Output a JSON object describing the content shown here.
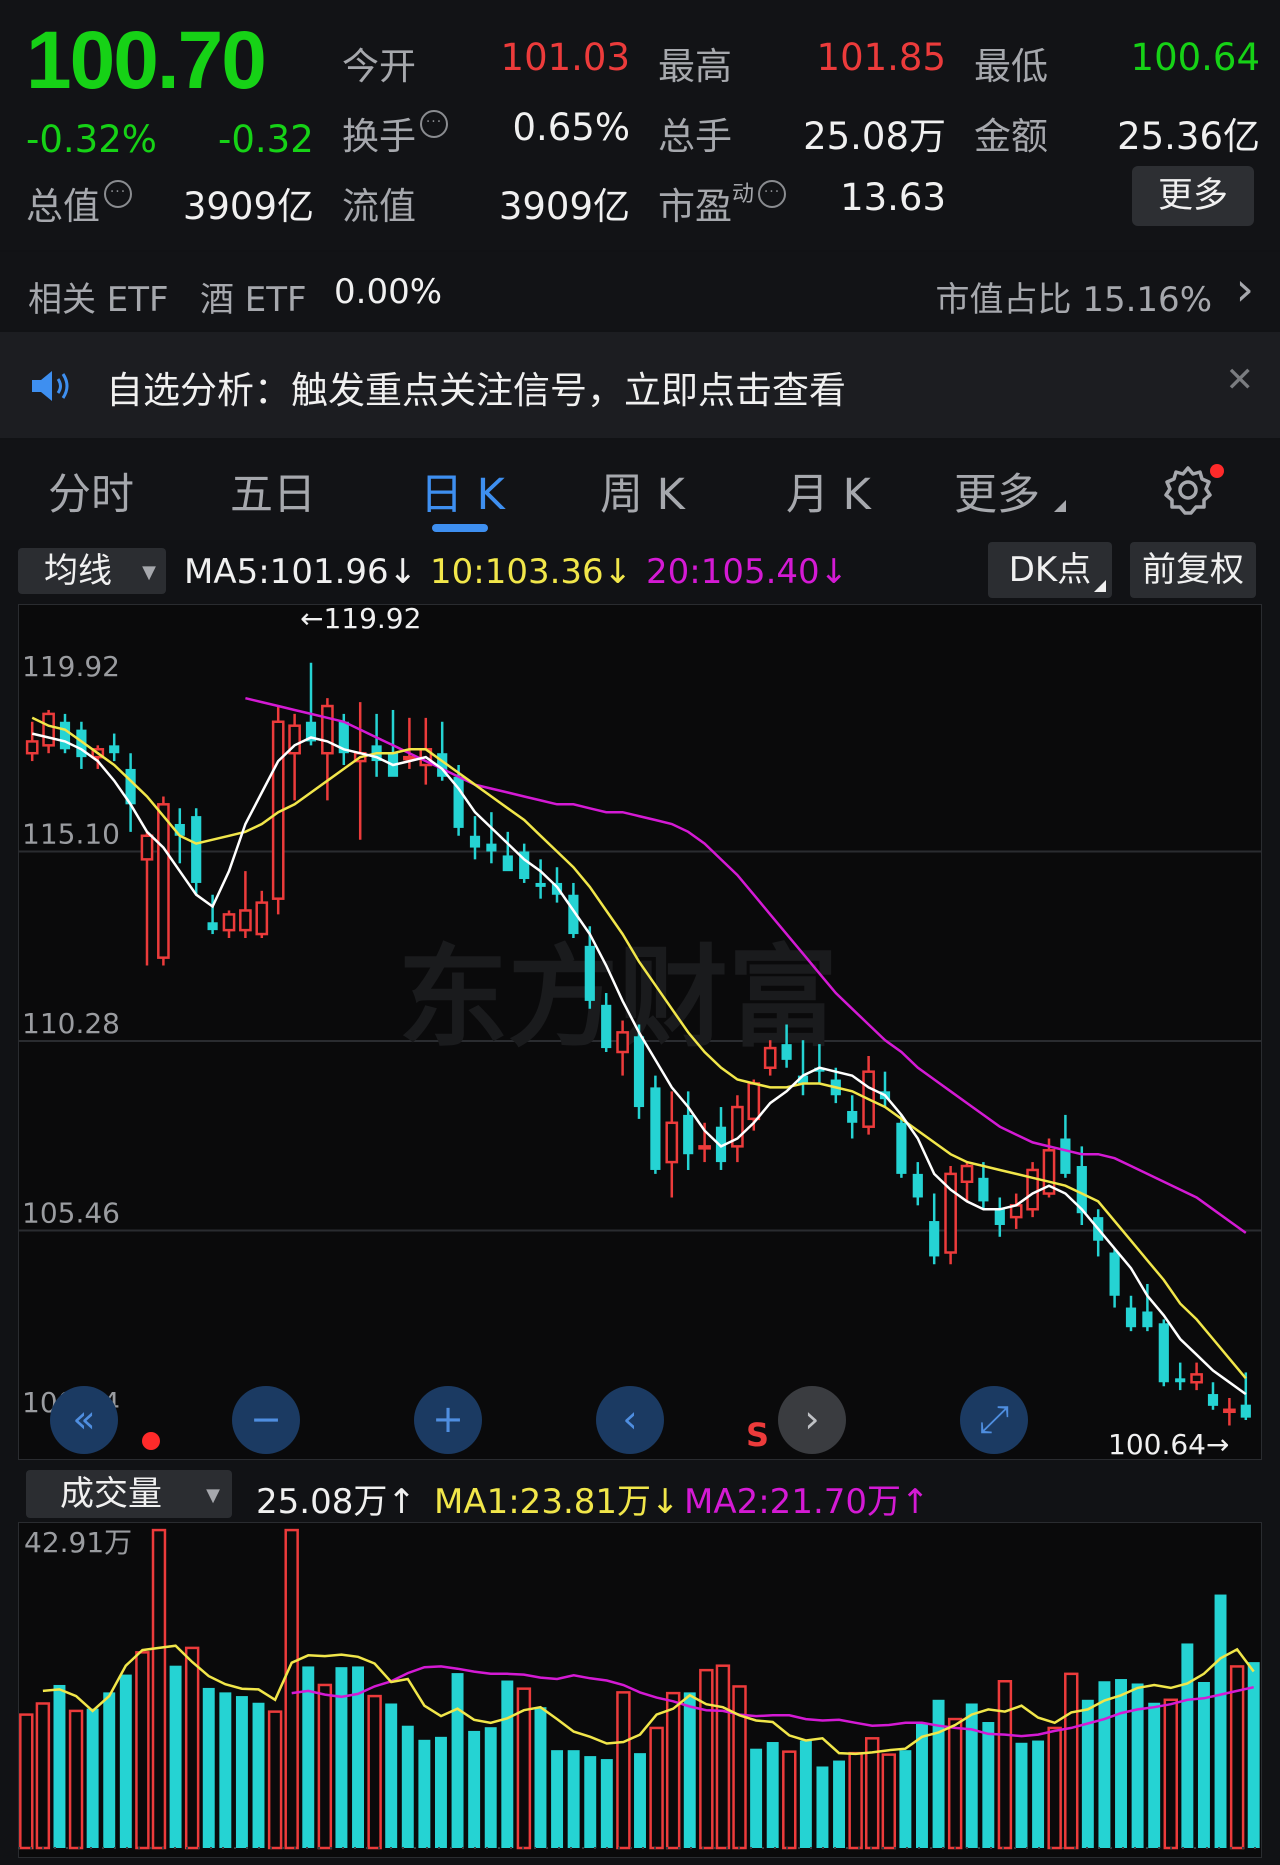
{
  "quote": {
    "price": "100.70",
    "change_pct": "-0.32%",
    "change": "-0.32",
    "open_label": "今开",
    "open": "101.03",
    "high_label": "最高",
    "high": "101.85",
    "low_label": "最低",
    "low": "100.64",
    "turnover_label": "换手",
    "turnover": "0.65%",
    "volume_label": "总手",
    "volume": "25.08万",
    "amount_label": "金额",
    "amount": "25.36亿",
    "mktcap_label": "总值",
    "mktcap": "3909亿",
    "float_label": "流值",
    "float_cap": "3909亿",
    "pe_label": "市盈",
    "pe_sup": "动",
    "pe": "13.63",
    "more_label": "更多",
    "info_icon_text": "···"
  },
  "etf": {
    "label": "相关 ETF",
    "name": "酒 ETF",
    "value": "0.00%",
    "share": "市值占比 15.16%",
    "arrow": "›"
  },
  "notice": {
    "text": "自选分析：触发重点关注信号，立即点击查看",
    "close": "✕"
  },
  "tabs": [
    {
      "label": "分时"
    },
    {
      "label": "五日"
    },
    {
      "label": "日 K"
    },
    {
      "label": "周 K"
    },
    {
      "label": "月 K"
    },
    {
      "label": "更多"
    }
  ],
  "ma_bar": {
    "select_label": "均线",
    "ma5": "MA5:101.96↓",
    "ma10": "10:103.36↓",
    "ma20": "20:105.40↓",
    "dk_label": "DK点",
    "adj_label": "前复权"
  },
  "price_axis": {
    "labels": [
      "119.92",
      "115.10",
      "110.28",
      "105.46",
      "100.64"
    ],
    "max_marker": "←119.92",
    "min_marker": "100.64→",
    "sell_marker": "S"
  },
  "controls": [
    "«",
    "−",
    "+",
    "‹",
    "›",
    "⤢"
  ],
  "vol_bar": {
    "select_label": "成交量",
    "vol": "25.08万↑",
    "ma1": "MA1:23.81万↓",
    "ma2": "MA2:21.70万↑",
    "axis_top": "42.91万"
  },
  "colors": {
    "up": "#ec3b3b",
    "down": "#25d3d3",
    "ma5": "#ffffff",
    "ma10": "#f1e64a",
    "ma20": "#d41ad4",
    "price_green": "#16d216",
    "accent": "#3e8ff0"
  },
  "chart_data": [
    {
      "type": "candlestick",
      "title": "",
      "ylim": [
        100.64,
        119.92
      ],
      "y_ticks": [
        119.92,
        115.1,
        110.28,
        105.46,
        100.64
      ],
      "candles": [
        {
          "o": 117.6,
          "h": 118.4,
          "l": 117.4,
          "c": 117.9
        },
        {
          "o": 117.8,
          "h": 118.7,
          "l": 117.6,
          "c": 118.6
        },
        {
          "o": 118.4,
          "h": 118.6,
          "l": 117.6,
          "c": 117.7
        },
        {
          "o": 118.2,
          "h": 118.4,
          "l": 117.2,
          "c": 117.5
        },
        {
          "o": 117.5,
          "h": 117.8,
          "l": 117.2,
          "c": 117.7
        },
        {
          "o": 117.8,
          "h": 118.1,
          "l": 117.4,
          "c": 117.6
        },
        {
          "o": 117.2,
          "h": 117.6,
          "l": 115.6,
          "c": 116.3
        },
        {
          "o": 114.9,
          "h": 115.6,
          "l": 112.2,
          "c": 115.5
        },
        {
          "o": 112.4,
          "h": 116.5,
          "l": 112.2,
          "c": 116.3
        },
        {
          "o": 115.8,
          "h": 116.2,
          "l": 114.8,
          "c": 115.5
        },
        {
          "o": 116.0,
          "h": 116.2,
          "l": 114.0,
          "c": 114.3
        },
        {
          "o": 113.3,
          "h": 114.0,
          "l": 113.0,
          "c": 113.1
        },
        {
          "o": 113.1,
          "h": 113.6,
          "l": 112.9,
          "c": 113.5
        },
        {
          "o": 113.1,
          "h": 114.6,
          "l": 112.9,
          "c": 113.6
        },
        {
          "o": 113.0,
          "h": 114.1,
          "l": 112.9,
          "c": 113.8
        },
        {
          "o": 113.9,
          "h": 118.8,
          "l": 113.5,
          "c": 118.4
        },
        {
          "o": 117.6,
          "h": 118.6,
          "l": 116.4,
          "c": 118.3
        },
        {
          "o": 118.4,
          "h": 119.9,
          "l": 117.8,
          "c": 117.9
        },
        {
          "o": 117.6,
          "h": 119.0,
          "l": 116.4,
          "c": 118.8
        },
        {
          "o": 118.4,
          "h": 118.6,
          "l": 117.3,
          "c": 117.6
        },
        {
          "o": 117.4,
          "h": 118.9,
          "l": 115.4,
          "c": 117.6
        },
        {
          "o": 117.8,
          "h": 118.6,
          "l": 117.0,
          "c": 117.4
        },
        {
          "o": 117.6,
          "h": 118.7,
          "l": 117.2,
          "c": 117.0
        },
        {
          "o": 117.5,
          "h": 118.5,
          "l": 117.2,
          "c": 117.5
        },
        {
          "o": 117.3,
          "h": 118.5,
          "l": 116.8,
          "c": 117.7
        },
        {
          "o": 117.6,
          "h": 118.4,
          "l": 116.9,
          "c": 117.0
        },
        {
          "o": 117.0,
          "h": 117.3,
          "l": 115.5,
          "c": 115.7
        },
        {
          "o": 115.5,
          "h": 116.0,
          "l": 114.9,
          "c": 115.2
        },
        {
          "o": 115.3,
          "h": 116.1,
          "l": 114.8,
          "c": 115.1
        },
        {
          "o": 115.0,
          "h": 115.6,
          "l": 114.8,
          "c": 114.6
        },
        {
          "o": 115.1,
          "h": 115.3,
          "l": 114.3,
          "c": 114.4
        },
        {
          "o": 114.3,
          "h": 114.9,
          "l": 113.9,
          "c": 114.2
        },
        {
          "o": 114.3,
          "h": 114.7,
          "l": 113.8,
          "c": 114.0
        },
        {
          "o": 114.0,
          "h": 114.3,
          "l": 112.9,
          "c": 113.0
        },
        {
          "o": 112.7,
          "h": 113.2,
          "l": 111.1,
          "c": 111.3
        },
        {
          "o": 111.2,
          "h": 111.5,
          "l": 110.0,
          "c": 110.1
        },
        {
          "o": 110.0,
          "h": 110.8,
          "l": 109.4,
          "c": 110.5
        },
        {
          "o": 110.4,
          "h": 110.7,
          "l": 108.3,
          "c": 108.6
        },
        {
          "o": 109.1,
          "h": 109.4,
          "l": 106.9,
          "c": 107.0
        },
        {
          "o": 107.2,
          "h": 109.0,
          "l": 106.3,
          "c": 108.2
        },
        {
          "o": 108.4,
          "h": 109.0,
          "l": 107.0,
          "c": 107.4
        },
        {
          "o": 107.6,
          "h": 108.2,
          "l": 107.2,
          "c": 107.6
        },
        {
          "o": 108.1,
          "h": 108.6,
          "l": 107.0,
          "c": 107.2
        },
        {
          "o": 107.6,
          "h": 108.9,
          "l": 107.2,
          "c": 108.6
        },
        {
          "o": 108.3,
          "h": 109.3,
          "l": 108.0,
          "c": 109.2
        },
        {
          "o": 109.6,
          "h": 110.3,
          "l": 109.4,
          "c": 110.1
        },
        {
          "o": 110.2,
          "h": 110.7,
          "l": 109.6,
          "c": 109.8
        },
        {
          "o": 109.4,
          "h": 110.3,
          "l": 108.9,
          "c": 109.2
        },
        {
          "o": 109.6,
          "h": 110.2,
          "l": 109.2,
          "c": 109.5
        },
        {
          "o": 109.3,
          "h": 109.6,
          "l": 108.7,
          "c": 108.9
        },
        {
          "o": 108.5,
          "h": 108.9,
          "l": 107.8,
          "c": 108.2
        },
        {
          "o": 108.1,
          "h": 109.9,
          "l": 107.9,
          "c": 109.5
        },
        {
          "o": 109.0,
          "h": 109.5,
          "l": 108.6,
          "c": 108.8
        },
        {
          "o": 108.2,
          "h": 108.4,
          "l": 106.8,
          "c": 106.9
        },
        {
          "o": 106.9,
          "h": 107.2,
          "l": 106.1,
          "c": 106.3
        },
        {
          "o": 105.7,
          "h": 106.4,
          "l": 104.6,
          "c": 104.8
        },
        {
          "o": 104.9,
          "h": 107.1,
          "l": 104.6,
          "c": 106.9
        },
        {
          "o": 106.7,
          "h": 107.2,
          "l": 106.2,
          "c": 107.1
        },
        {
          "o": 106.8,
          "h": 107.2,
          "l": 106.0,
          "c": 106.2
        },
        {
          "o": 106.0,
          "h": 106.3,
          "l": 105.3,
          "c": 105.6
        },
        {
          "o": 105.8,
          "h": 106.4,
          "l": 105.5,
          "c": 106.1
        },
        {
          "o": 106.0,
          "h": 107.2,
          "l": 105.8,
          "c": 107.0
        },
        {
          "o": 106.4,
          "h": 107.8,
          "l": 106.3,
          "c": 107.5
        },
        {
          "o": 107.8,
          "h": 108.4,
          "l": 106.8,
          "c": 106.9
        },
        {
          "o": 107.1,
          "h": 107.6,
          "l": 105.6,
          "c": 105.9
        },
        {
          "o": 105.8,
          "h": 106.0,
          "l": 104.8,
          "c": 105.2
        },
        {
          "o": 104.9,
          "h": 105.0,
          "l": 103.5,
          "c": 103.8
        },
        {
          "o": 103.5,
          "h": 103.8,
          "l": 102.9,
          "c": 103.0
        },
        {
          "o": 103.4,
          "h": 104.1,
          "l": 102.9,
          "c": 103.0
        },
        {
          "o": 103.1,
          "h": 103.2,
          "l": 101.5,
          "c": 101.6
        },
        {
          "o": 101.7,
          "h": 102.1,
          "l": 101.4,
          "c": 101.6
        },
        {
          "o": 101.6,
          "h": 102.1,
          "l": 101.4,
          "c": 101.8
        },
        {
          "o": 101.3,
          "h": 101.6,
          "l": 100.9,
          "c": 101.0
        },
        {
          "o": 100.9,
          "h": 101.2,
          "l": 100.5,
          "c": 100.9
        },
        {
          "o": 101.03,
          "h": 101.85,
          "l": 100.64,
          "c": 100.7
        }
      ],
      "ma5": [
        118.1,
        118.0,
        117.9,
        117.7,
        117.4,
        116.9,
        116.3,
        115.6,
        115.2,
        114.6,
        114.0,
        113.7,
        114.6,
        115.8,
        116.6,
        117.4,
        117.8,
        118.0,
        117.9,
        117.7,
        117.6,
        117.5,
        117.3,
        117.4,
        117.5,
        117.2,
        116.7,
        116.1,
        115.7,
        115.3,
        114.9,
        114.6,
        114.2,
        113.6,
        113.0,
        112.2,
        111.3,
        110.5,
        109.8,
        109.1,
        108.6,
        108.0,
        107.6,
        107.8,
        108.2,
        108.7,
        109.0,
        109.4,
        109.6,
        109.5,
        109.4,
        109.1,
        108.9,
        108.4,
        107.8,
        106.9,
        106.5,
        106.2,
        106.0,
        106.0,
        106.1,
        106.4,
        106.6,
        106.4,
        106.0,
        105.5,
        105.0,
        104.5,
        103.8,
        103.3,
        102.7,
        102.3,
        101.9,
        101.6,
        101.3
      ],
      "ma10": [
        118.5,
        118.3,
        118.2,
        117.9,
        117.6,
        117.3,
        116.9,
        116.5,
        116.0,
        115.5,
        115.3,
        115.4,
        115.5,
        115.6,
        115.8,
        116.1,
        116.3,
        116.6,
        116.9,
        117.2,
        117.5,
        117.6,
        117.6,
        117.7,
        117.7,
        117.4,
        117.1,
        116.8,
        116.5,
        116.2,
        115.9,
        115.5,
        115.1,
        114.7,
        114.2,
        113.6,
        113.0,
        112.3,
        111.7,
        111.1,
        110.5,
        110.0,
        109.6,
        109.3,
        109.2,
        109.1,
        109.1,
        109.2,
        109.2,
        109.1,
        109.0,
        108.8,
        108.6,
        108.3,
        108.0,
        107.7,
        107.4,
        107.2,
        107.1,
        107.0,
        106.9,
        106.8,
        106.7,
        106.6,
        106.4,
        106.2,
        105.7,
        105.2,
        104.7,
        104.2,
        103.6,
        103.2,
        102.7,
        102.2,
        101.7
      ],
      "ma20": [
        119.0,
        118.9,
        118.8,
        118.7,
        118.6,
        118.5,
        118.4,
        118.2,
        118.0,
        117.8,
        117.6,
        117.4,
        117.2,
        117.0,
        116.8,
        116.7,
        116.6,
        116.5,
        116.4,
        116.3,
        116.3,
        116.2,
        116.1,
        116.1,
        116.0,
        115.9,
        115.8,
        115.6,
        115.3,
        114.9,
        114.5,
        114.0,
        113.5,
        113.0,
        112.5,
        112.0,
        111.5,
        111.1,
        110.7,
        110.3,
        110.0,
        109.6,
        109.3,
        109.0,
        108.7,
        108.4,
        108.1,
        107.9,
        107.7,
        107.6,
        107.5,
        107.4,
        107.4,
        107.3,
        107.1,
        106.9,
        106.7,
        106.5,
        106.3,
        106.0,
        105.7,
        105.4
      ]
    },
    {
      "type": "bar",
      "title": "",
      "ylim": [
        0,
        42.91
      ],
      "unit": "万",
      "values": [
        18.0,
        19.5,
        22.0,
        18.5,
        18.8,
        21.0,
        23.4,
        26.4,
        42.9,
        24.6,
        27.0,
        21.6,
        21.0,
        20.5,
        19.6,
        18.4,
        42.9,
        24.5,
        22.0,
        24.4,
        24.5,
        20.5,
        19.5,
        16.5,
        14.6,
        15.0,
        23.6,
        15.8,
        16.3,
        22.6,
        21.5,
        19.0,
        13.2,
        13.2,
        12.4,
        12.0,
        21.0,
        12.8,
        16.2,
        20.9,
        21.0,
        24.0,
        24.6,
        21.8,
        13.4,
        14.3,
        13.0,
        14.5,
        11.0,
        11.8,
        12.8,
        14.8,
        12.6,
        13.2,
        16.8,
        20.0,
        17.4,
        19.5,
        17.0,
        22.5,
        14.2,
        14.5,
        16.2,
        23.5,
        20.0,
        22.5,
        22.8,
        22.2,
        19.6,
        20.0,
        27.6,
        22.4,
        34.2,
        24.5,
        25.08
      ],
      "up": [
        1,
        1,
        0,
        1,
        0,
        0,
        0,
        1,
        1,
        0,
        1,
        0,
        0,
        0,
        0,
        1,
        1,
        0,
        1,
        0,
        0,
        1,
        0,
        0,
        0,
        0,
        0,
        0,
        0,
        0,
        1,
        0,
        0,
        0,
        0,
        0,
        1,
        0,
        1,
        1,
        0,
        1,
        1,
        1,
        0,
        0,
        1,
        0,
        0,
        0,
        1,
        1,
        1,
        0,
        0,
        0,
        1,
        0,
        0,
        1,
        0,
        0,
        1,
        1,
        0,
        0,
        0,
        0,
        0,
        1,
        0,
        0,
        0,
        1,
        0
      ],
      "ma1": [
        21.2,
        21.4,
        20.5,
        18.5,
        20.5,
        24.6,
        26.7,
        27.0,
        27.3,
        25.1,
        23.2,
        22.1,
        21.5,
        21.4,
        20.0,
        25.0,
        26.0,
        25.9,
        26.1,
        25.8,
        24.9,
        22.4,
        22.8,
        19.2,
        17.8,
        18.8,
        17.3,
        16.9,
        17.5,
        18.6,
        19.0,
        17.4,
        15.7,
        15.0,
        14.1,
        14.3,
        15.3,
        18.0,
        18.8,
        20.6,
        19.4,
        19.0,
        17.9,
        17.2,
        17.0,
        15.2,
        14.5,
        14.8,
        12.8,
        12.7,
        12.9,
        13.2,
        13.4,
        15.0,
        15.6,
        16.6,
        18.0,
        18.7,
        18.4,
        19.2,
        17.6,
        16.9,
        18.3,
        18.7,
        19.9,
        20.6,
        21.6,
        22.0,
        21.6,
        22.2,
        23.5,
        25.6,
        26.8,
        23.81
      ],
      "ma2": [
        20.9,
        21.2,
        20.7,
        20.4,
        20.8,
        21.8,
        22.5,
        23.6,
        24.4,
        24.5,
        24.2,
        23.8,
        23.5,
        23.5,
        23.4,
        23.0,
        22.8,
        23.3,
        22.9,
        22.6,
        22.0,
        21.0,
        20.3,
        19.8,
        19.1,
        18.6,
        18.5,
        18.0,
        17.8,
        17.9,
        17.9,
        17.4,
        17.2,
        17.3,
        16.9,
        16.5,
        16.6,
        16.9,
        16.9,
        16.5,
        16.2,
        16.0,
        15.4,
        15.3,
        15.1,
        15.3,
        15.8,
        16.2,
        16.8,
        17.4,
        18.2,
        18.7,
        19.0,
        19.4,
        20.0,
        20.2,
        20.7,
        21.2,
        21.7
      ]
    }
  ]
}
